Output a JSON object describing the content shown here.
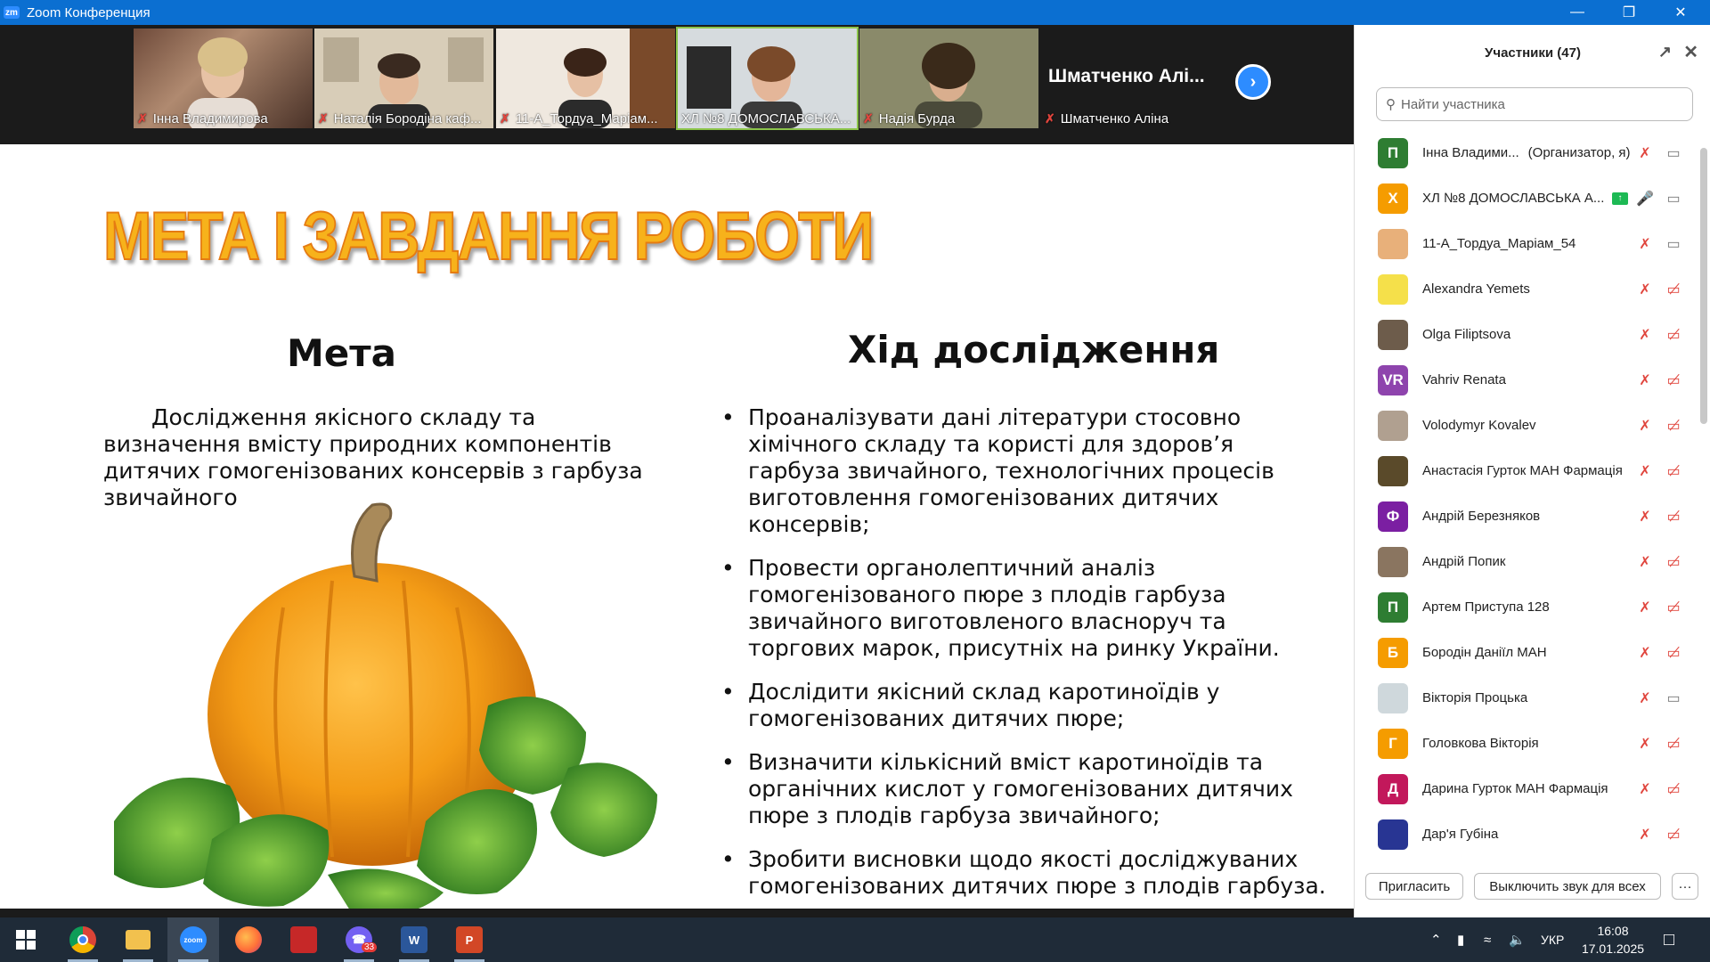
{
  "window": {
    "app_logo": "zm",
    "title": "Zoom Конференция",
    "minimize_icon": "minimize-icon",
    "restore_icon": "restore-icon",
    "close_icon": "close-icon"
  },
  "video_strip": {
    "tiles": [
      {
        "name": "Інна Владимирова",
        "muted": true
      },
      {
        "name": "Наталія Бородіна каф...",
        "muted": true
      },
      {
        "name": "11-А_Тордуа_Маріам...",
        "muted": true
      },
      {
        "name": "ХЛ №8 ДОМОСЛАВСЬКА...",
        "muted": false,
        "active": true
      },
      {
        "name": "Надія Бурда",
        "muted": true
      },
      {
        "name": "Шматченко Аліна",
        "big_name": "Шматченко Алі...",
        "muted": true
      }
    ],
    "next_icon": "chevron-right-icon"
  },
  "slide": {
    "title": "МЕТА І ЗАВДАННЯ РОБОТИ",
    "goal_heading": "Мета",
    "goal_text": "Дослідження якісного складу та визначення вмісту природних компонентів дитячих гомогенізованих консервів з гарбуза звичайного",
    "steps_heading": "Хід дослідження",
    "steps": [
      "Проаналізувати дані літератури стосовно хімічного складу та користі для здоров’я гарбуза звичайного, технологічних процесів виготовлення гомогенізованих дитячих консервів;",
      "Провести органолептичний аналіз гомогенізованого пюре з плодів гарбуза звичайного виготовленого власноруч та торгових марок, присутніх на ринку України.",
      "Дослідити якісний склад каротиноїдів у гомогенізованих дитячих пюре;",
      "Визначити кількісний вміст каротиноїдів та органічних кислот у гомогенізованих дитячих пюре з плодів гарбуза звичайного;",
      "Зробити висновки щодо якості досліджуваних гомогенізованих дитячих пюре з плодів гарбуза."
    ],
    "bullet": "•",
    "title_color": "#f7b21b"
  },
  "participants": {
    "header": "Участники (47)",
    "search_placeholder": "Найти участника",
    "list": [
      {
        "initial": "П",
        "color": "#2e7d32",
        "name": "Інна Владими...",
        "role": "(Организатор, я)",
        "mic": "muted",
        "video": "off-gray"
      },
      {
        "initial": "Х",
        "color": "#f59c00",
        "name": "ХЛ №8 ДОМОСЛАВСЬКА А...",
        "role": "",
        "share": true,
        "mic": "on",
        "video": "off-gray"
      },
      {
        "initial": "",
        "color": "#e8b07a",
        "name": "11-А_Тордуа_Маріам_54",
        "role": "",
        "mic": "muted",
        "video": "off-gray"
      },
      {
        "initial": "",
        "color": "#f5e04a",
        "name": "Alexandra Yemets",
        "role": "",
        "mic": "muted",
        "video": "muted"
      },
      {
        "initial": "",
        "color": "#6d5c4b",
        "name": "Olga Filiptsova",
        "role": "",
        "mic": "muted",
        "video": "muted"
      },
      {
        "initial": "VR",
        "color": "#8e44ad",
        "name": "Vahriv Renata",
        "role": "",
        "mic": "muted",
        "video": "muted"
      },
      {
        "initial": "",
        "color": "#b0a090",
        "name": "Volodymyr Kovalev",
        "role": "",
        "mic": "muted",
        "video": "muted"
      },
      {
        "initial": "",
        "color": "#5a4a2a",
        "name": "Анастасія Гурток МАН Фармація",
        "role": "",
        "mic": "muted",
        "video": "muted"
      },
      {
        "initial": "Ф",
        "color": "#7b1fa2",
        "name": "Андрій Березняков",
        "role": "",
        "mic": "muted",
        "video": "muted"
      },
      {
        "initial": "",
        "color": "#8a7560",
        "name": "Андрій Попик",
        "role": "",
        "mic": "muted",
        "video": "muted"
      },
      {
        "initial": "П",
        "color": "#2e7d32",
        "name": "Артем Приступа 128",
        "role": "",
        "mic": "muted",
        "video": "muted"
      },
      {
        "initial": "Б",
        "color": "#f59c00",
        "name": "Бородін Даніїл МАН",
        "role": "",
        "mic": "muted",
        "video": "muted"
      },
      {
        "initial": "",
        "color": "#cfd8dc",
        "name": "Вікторія Процька",
        "role": "",
        "mic": "muted",
        "video": "off-gray"
      },
      {
        "initial": "Г",
        "color": "#f59c00",
        "name": "Головкова Вікторія",
        "role": "",
        "mic": "muted",
        "video": "muted"
      },
      {
        "initial": "Д",
        "color": "#c2185b",
        "name": "Дарина Гурток МАН Фармація",
        "role": "",
        "mic": "muted",
        "video": "muted"
      },
      {
        "initial": "",
        "color": "#283593",
        "name": "Дар'я Губіна",
        "role": "",
        "mic": "muted",
        "video": "muted"
      }
    ],
    "invite_label": "Пригласить",
    "mute_all_label": "Выключить звук для всех",
    "more_label": "···"
  },
  "taskbar": {
    "apps": [
      {
        "name": "windows-start",
        "label": ""
      },
      {
        "name": "chrome",
        "label": "",
        "color": "#db4437"
      },
      {
        "name": "file-explorer",
        "label": "",
        "color": "#f2c14e"
      },
      {
        "name": "zoom",
        "label": "zoom",
        "color": "#2d8cff"
      },
      {
        "name": "firefox",
        "label": "",
        "color": "#ff7139"
      },
      {
        "name": "app-red",
        "label": "",
        "color": "#c62828"
      },
      {
        "name": "viber",
        "label": "",
        "color": "#7360f2",
        "badge": "33"
      },
      {
        "name": "word",
        "label": "W",
        "color": "#2b579a"
      },
      {
        "name": "powerpoint",
        "label": "P",
        "color": "#d24726"
      }
    ],
    "language": "УКР",
    "time": "16:08",
    "date": "17.01.2025"
  }
}
